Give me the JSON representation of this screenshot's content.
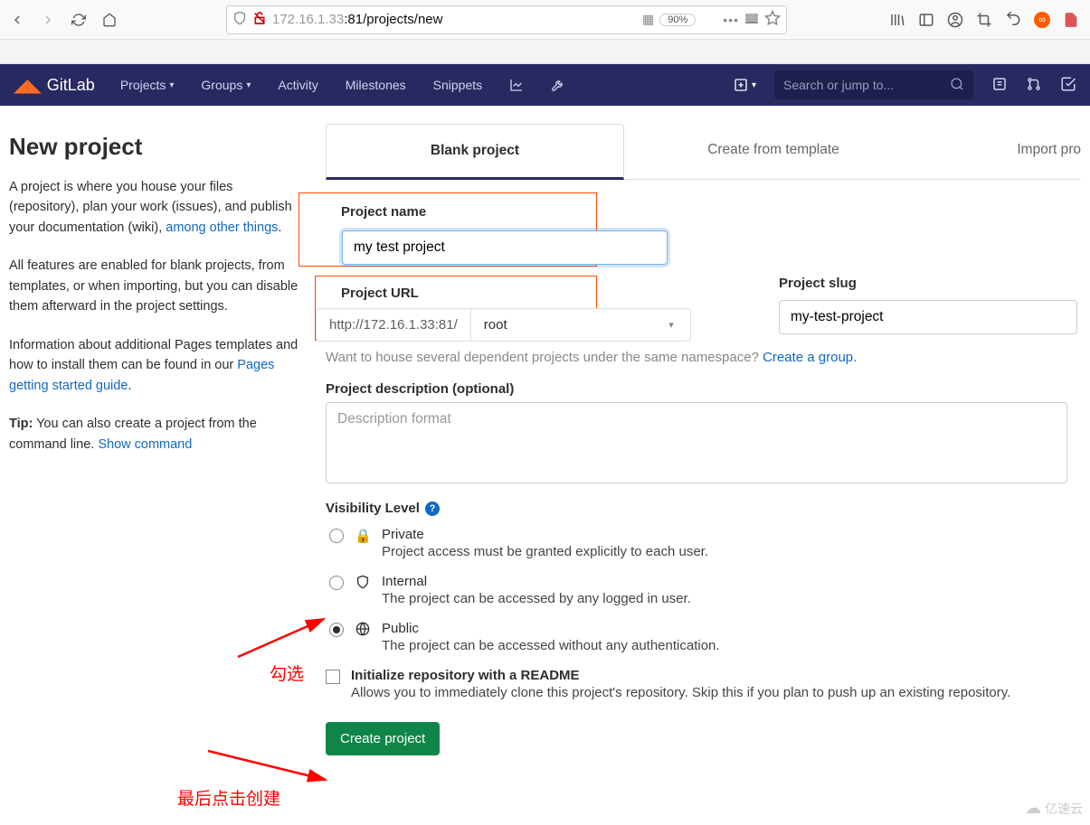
{
  "browser": {
    "url_host": "172.16.1.33",
    "url_port": ":81",
    "url_path": "/projects/new",
    "zoom": "90%"
  },
  "header": {
    "brand": "GitLab",
    "nav": [
      "Projects",
      "Groups",
      "Activity",
      "Milestones",
      "Snippets"
    ],
    "search_placeholder": "Search or jump to..."
  },
  "sidebar": {
    "title": "New project",
    "p1_a": "A project is where you house your files (repository), plan your work (issues), and publish your documentation (wiki), ",
    "p1_link": "among other things",
    "p2": "All features are enabled for blank projects, from templates, or when importing, but you can disable them afterward in the project settings.",
    "p3_a": "Information about additional Pages templates and how to install them can be found in our ",
    "p3_link": "Pages getting started guide",
    "p4_tip": "Tip:",
    "p4_a": " You can also create a project from the command line. ",
    "p4_link": "Show command"
  },
  "tabs": {
    "blank": "Blank project",
    "template": "Create from template",
    "import": "Import pro"
  },
  "form": {
    "project_name_label": "Project name",
    "project_name_value": "my test project",
    "project_url_label": "Project URL",
    "project_url_base": "http://172.16.1.33:81/",
    "project_url_namespace": "root",
    "project_slug_label": "Project slug",
    "project_slug_value": "my-test-project",
    "namespace_hint_a": "Want to house several dependent projects under the same namespace? ",
    "namespace_hint_link": "Create a group.",
    "desc_label": "Project description (optional)",
    "desc_placeholder": "Description format",
    "vis_label": "Visibility Level",
    "vis": [
      {
        "key": "private",
        "title": "Private",
        "desc": "Project access must be granted explicitly to each user.",
        "checked": false
      },
      {
        "key": "internal",
        "title": "Internal",
        "desc": "The project can be accessed by any logged in user.",
        "checked": false
      },
      {
        "key": "public",
        "title": "Public",
        "desc": "The project can be accessed without any authentication.",
        "checked": true
      }
    ],
    "readme_title": "Initialize repository with a README",
    "readme_desc": "Allows you to immediately clone this project's repository. Skip this if you plan to push up an existing repository.",
    "create_btn": "Create project"
  },
  "annotations": {
    "select": "勾选",
    "click_create": "最后点击创建"
  },
  "watermark": "亿速云"
}
